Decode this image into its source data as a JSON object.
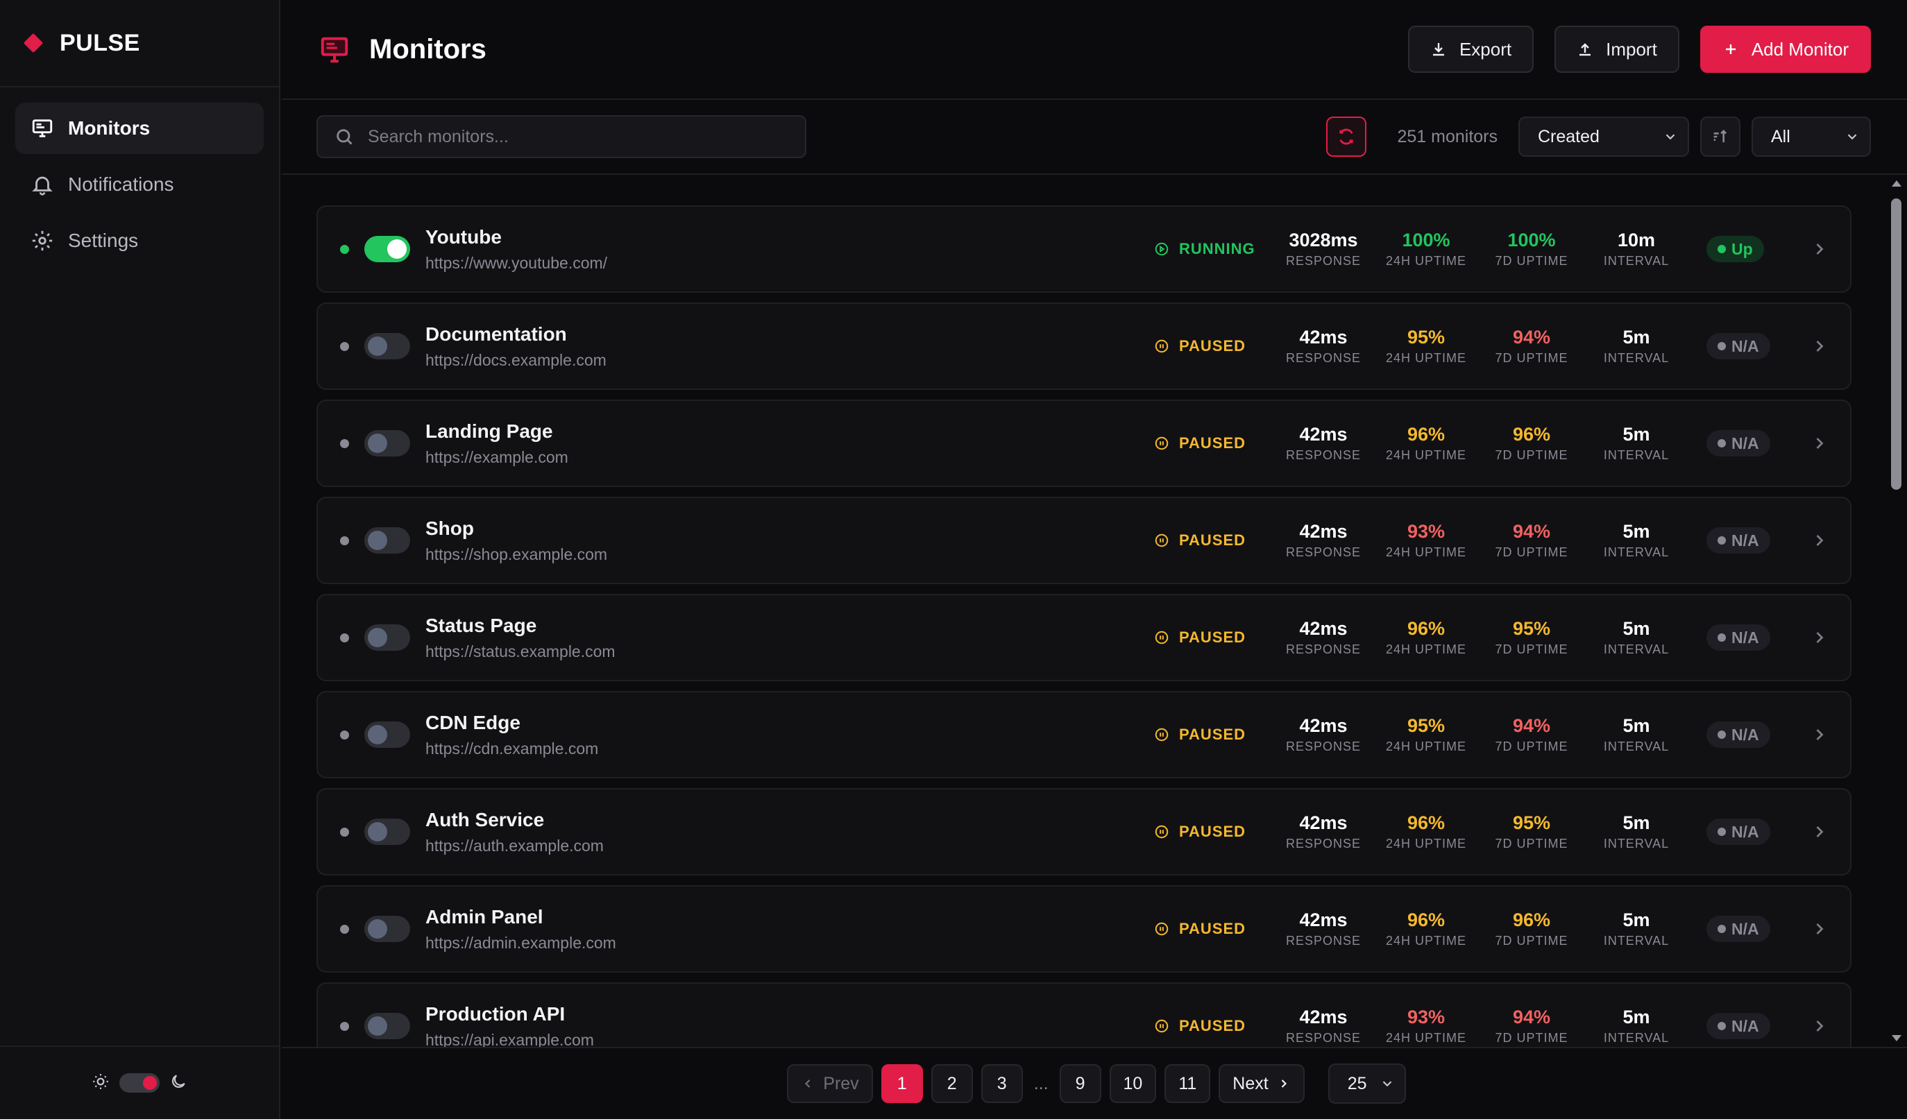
{
  "brand": {
    "name": "PULSE"
  },
  "nav": [
    {
      "label": "Monitors",
      "icon": "monitor-icon",
      "active": true
    },
    {
      "label": "Notifications",
      "icon": "bell-icon",
      "active": false
    },
    {
      "label": "Settings",
      "icon": "gear-icon",
      "active": false
    }
  ],
  "header": {
    "title": "Monitors",
    "export_label": "Export",
    "import_label": "Import",
    "add_label": "Add Monitor"
  },
  "toolbar": {
    "search_placeholder": "Search monitors...",
    "count": "251 monitors",
    "sort_value": "Created",
    "filter_value": "All"
  },
  "colors": {
    "accent": "#e11d48",
    "up": "#22c55e",
    "warn": "#f5b82e",
    "bad": "#f26161"
  },
  "stat_labels": {
    "response": "RESPONSE",
    "uptime24": "24H UPTIME",
    "uptime7": "7D UPTIME",
    "interval": "INTERVAL"
  },
  "monitors": [
    {
      "name": "Youtube",
      "url": "https://www.youtube.com/",
      "enabled": true,
      "state": "RUNNING",
      "response": "3028ms",
      "uptime24": "100%",
      "uptime24_level": "green",
      "uptime7": "100%",
      "uptime7_level": "green",
      "interval": "10m",
      "badge": "Up"
    },
    {
      "name": "Documentation",
      "url": "https://docs.example.com",
      "enabled": false,
      "state": "PAUSED",
      "response": "42ms",
      "uptime24": "95%",
      "uptime24_level": "amber",
      "uptime7": "94%",
      "uptime7_level": "red",
      "interval": "5m",
      "badge": "N/A"
    },
    {
      "name": "Landing Page",
      "url": "https://example.com",
      "enabled": false,
      "state": "PAUSED",
      "response": "42ms",
      "uptime24": "96%",
      "uptime24_level": "amber",
      "uptime7": "96%",
      "uptime7_level": "amber",
      "interval": "5m",
      "badge": "N/A"
    },
    {
      "name": "Shop",
      "url": "https://shop.example.com",
      "enabled": false,
      "state": "PAUSED",
      "response": "42ms",
      "uptime24": "93%",
      "uptime24_level": "red",
      "uptime7": "94%",
      "uptime7_level": "red",
      "interval": "5m",
      "badge": "N/A"
    },
    {
      "name": "Status Page",
      "url": "https://status.example.com",
      "enabled": false,
      "state": "PAUSED",
      "response": "42ms",
      "uptime24": "96%",
      "uptime24_level": "amber",
      "uptime7": "95%",
      "uptime7_level": "amber",
      "interval": "5m",
      "badge": "N/A"
    },
    {
      "name": "CDN Edge",
      "url": "https://cdn.example.com",
      "enabled": false,
      "state": "PAUSED",
      "response": "42ms",
      "uptime24": "95%",
      "uptime24_level": "amber",
      "uptime7": "94%",
      "uptime7_level": "red",
      "interval": "5m",
      "badge": "N/A"
    },
    {
      "name": "Auth Service",
      "url": "https://auth.example.com",
      "enabled": false,
      "state": "PAUSED",
      "response": "42ms",
      "uptime24": "96%",
      "uptime24_level": "amber",
      "uptime7": "95%",
      "uptime7_level": "amber",
      "interval": "5m",
      "badge": "N/A"
    },
    {
      "name": "Admin Panel",
      "url": "https://admin.example.com",
      "enabled": false,
      "state": "PAUSED",
      "response": "42ms",
      "uptime24": "96%",
      "uptime24_level": "amber",
      "uptime7": "96%",
      "uptime7_level": "amber",
      "interval": "5m",
      "badge": "N/A"
    },
    {
      "name": "Production API",
      "url": "https://api.example.com",
      "enabled": false,
      "state": "PAUSED",
      "response": "42ms",
      "uptime24": "93%",
      "uptime24_level": "red",
      "uptime7": "94%",
      "uptime7_level": "red",
      "interval": "5m",
      "badge": "N/A"
    }
  ],
  "pagination": {
    "prev_label": "Prev",
    "next_label": "Next",
    "pages": [
      "1",
      "2",
      "3",
      "9",
      "10",
      "11"
    ],
    "current": "1",
    "ellipsis": "...",
    "per_page": "25"
  }
}
